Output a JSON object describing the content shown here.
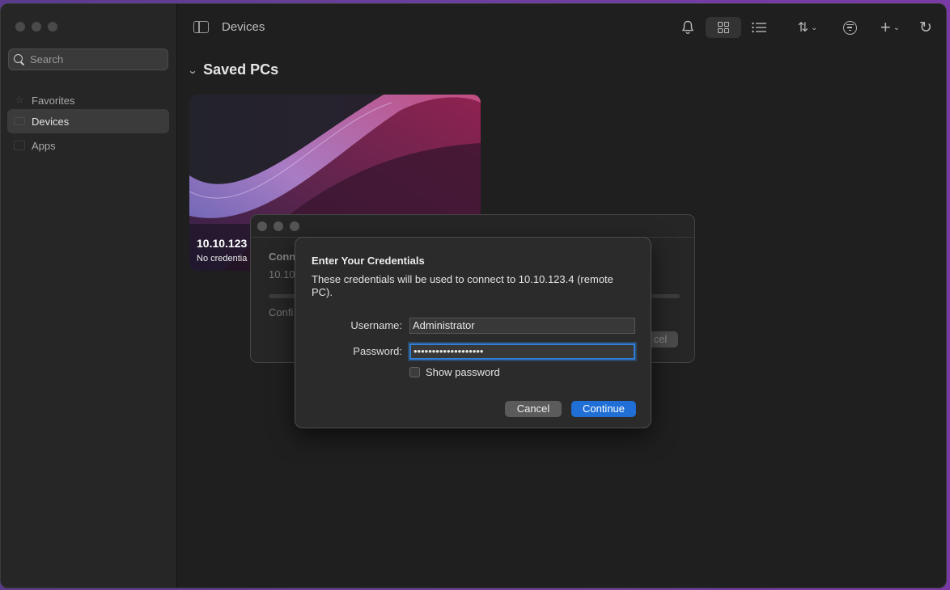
{
  "sidebar": {
    "search_placeholder": "Search",
    "items": [
      {
        "label": "Favorites",
        "icon": "star-icon",
        "active": false
      },
      {
        "label": "Devices",
        "icon": "monitor-icon",
        "active": true
      },
      {
        "label": "Apps",
        "icon": "apps-icon",
        "active": false
      }
    ]
  },
  "toolbar": {
    "title": "Devices",
    "icons": [
      "bell-icon",
      "grid-view-icon",
      "list-view-icon",
      "sort-icon",
      "filter-icon",
      "add-icon",
      "refresh-icon"
    ]
  },
  "main": {
    "section_title": "Saved PCs",
    "pc": {
      "name": "10.10.123",
      "subtitle": "No credentia"
    }
  },
  "connecting_dialog": {
    "line1": "Conn",
    "line2": "10.10.",
    "line3": "Confi",
    "cancel_fragment": "cel"
  },
  "credentials_dialog": {
    "title": "Enter Your Credentials",
    "description": "These credentials will be used to connect to 10.10.123.4 (remote PC).",
    "username_label": "Username:",
    "username_value": "Administrator",
    "password_label": "Password:",
    "password_value": "•••••••••••••••••••",
    "show_password_label": "Show password",
    "show_password_checked": false,
    "cancel_label": "Cancel",
    "continue_label": "Continue"
  },
  "colors": {
    "accent": "#1f6fd6",
    "window_bg": "#1f1f1f",
    "sidebar_bg": "#262626"
  }
}
